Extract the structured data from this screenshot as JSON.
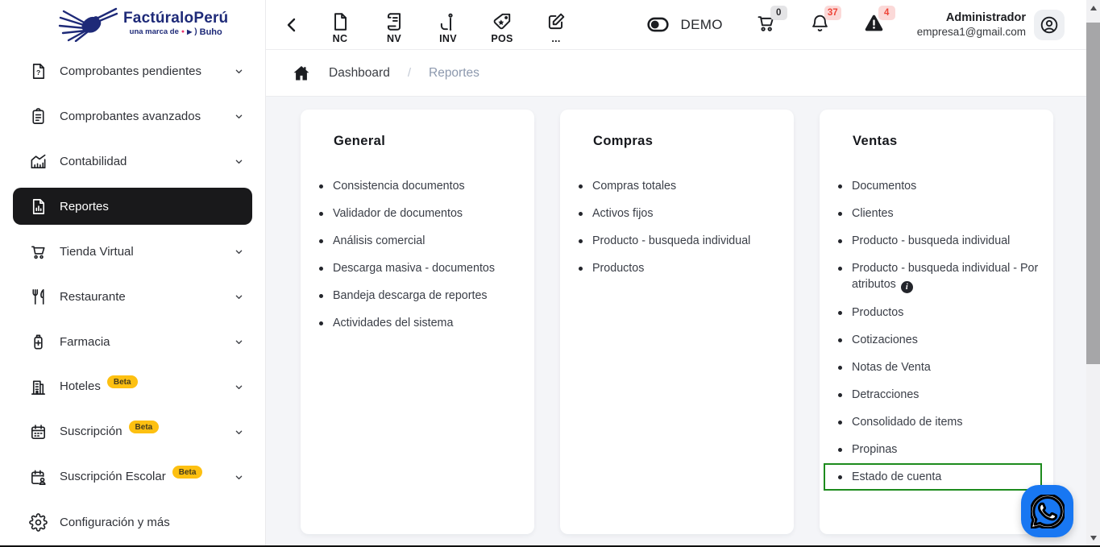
{
  "colors": {
    "brand_navy": "#1e2a78",
    "active_item_bg": "#19191b",
    "beta_yellow": "#fdc011",
    "badge_neutral_bg": "#e4e4e6",
    "badge_alert_bg": "#fbd9d8",
    "badge_alert_text": "#ee4437",
    "accent_green": "#1d8b1d",
    "whatsapp_blue": "#1877f2"
  },
  "logo": {
    "brand_primary": "Factúralo",
    "brand_secondary": "Perú",
    "tagline": "una marca de",
    "tagline_brand": "Buho"
  },
  "sidebar": {
    "beta_label": "Beta",
    "items": [
      {
        "label": "Comprobantes pendientes",
        "icon": "document-question-icon",
        "chevron": true
      },
      {
        "label": "Comprobantes avanzados",
        "icon": "clipboard-icon",
        "chevron": true
      },
      {
        "label": "Contabilidad",
        "icon": "accounting-chart-icon",
        "chevron": true
      },
      {
        "label": "Reportes",
        "icon": "report-document-icon",
        "active": true
      },
      {
        "label": "Tienda Virtual",
        "icon": "cart-icon",
        "chevron": true
      },
      {
        "label": "Restaurante",
        "icon": "restaurant-icon",
        "chevron": true
      },
      {
        "label": "Farmacia",
        "icon": "pharmacy-icon",
        "chevron": true
      },
      {
        "label": "Hoteles",
        "icon": "hotel-icon",
        "beta": true,
        "chevron": true
      },
      {
        "label": "Suscripción",
        "icon": "calendar-icon",
        "beta": true,
        "chevron": true
      },
      {
        "label": "Suscripción Escolar",
        "icon": "calendar-user-icon",
        "beta": true,
        "chevron": true
      },
      {
        "label": "Configuración y más",
        "icon": "gear-icon"
      }
    ]
  },
  "topbar": {
    "quick_actions": [
      {
        "label": "NC",
        "icon": "credit-note-icon"
      },
      {
        "label": "NV",
        "icon": "sales-note-icon"
      },
      {
        "label": "INV",
        "icon": "invoice-pen-icon"
      },
      {
        "label": "POS",
        "icon": "pos-tag-icon"
      },
      {
        "label": "...",
        "icon": "edit-icon"
      }
    ],
    "demo_label": "DEMO",
    "badges": {
      "cart": "0",
      "notifications": "37",
      "alerts": "4"
    },
    "user": {
      "name": "Administrador",
      "email": "empresa1@gmail.com"
    }
  },
  "breadcrumb": {
    "separator": "/",
    "items": [
      {
        "label": "Dashboard"
      },
      {
        "label": "Reportes",
        "current": true
      }
    ]
  },
  "cards": [
    {
      "title": "General",
      "items": [
        {
          "label": "Consistencia documentos"
        },
        {
          "label": "Validador de documentos"
        },
        {
          "label": "Análisis comercial"
        },
        {
          "label": "Descarga masiva - documentos"
        },
        {
          "label": "Bandeja descarga de reportes"
        },
        {
          "label": "Actividades del sistema"
        }
      ]
    },
    {
      "title": "Compras",
      "items": [
        {
          "label": "Compras totales"
        },
        {
          "label": "Activos fijos"
        },
        {
          "label": "Producto - busqueda individual"
        },
        {
          "label": "Productos"
        }
      ]
    },
    {
      "title": "Ventas",
      "items": [
        {
          "label": "Documentos"
        },
        {
          "label": "Clientes"
        },
        {
          "label": "Producto - busqueda individual"
        },
        {
          "label": "Producto - busqueda individual - Por atributos",
          "info": true
        },
        {
          "label": "Productos"
        },
        {
          "label": "Cotizaciones"
        },
        {
          "label": "Notas de Venta"
        },
        {
          "label": "Detracciones"
        },
        {
          "label": "Consolidado de items"
        },
        {
          "label": "Propinas"
        },
        {
          "label": "Estado de cuenta",
          "highlighted": true
        }
      ]
    }
  ],
  "info_symbol": "i"
}
